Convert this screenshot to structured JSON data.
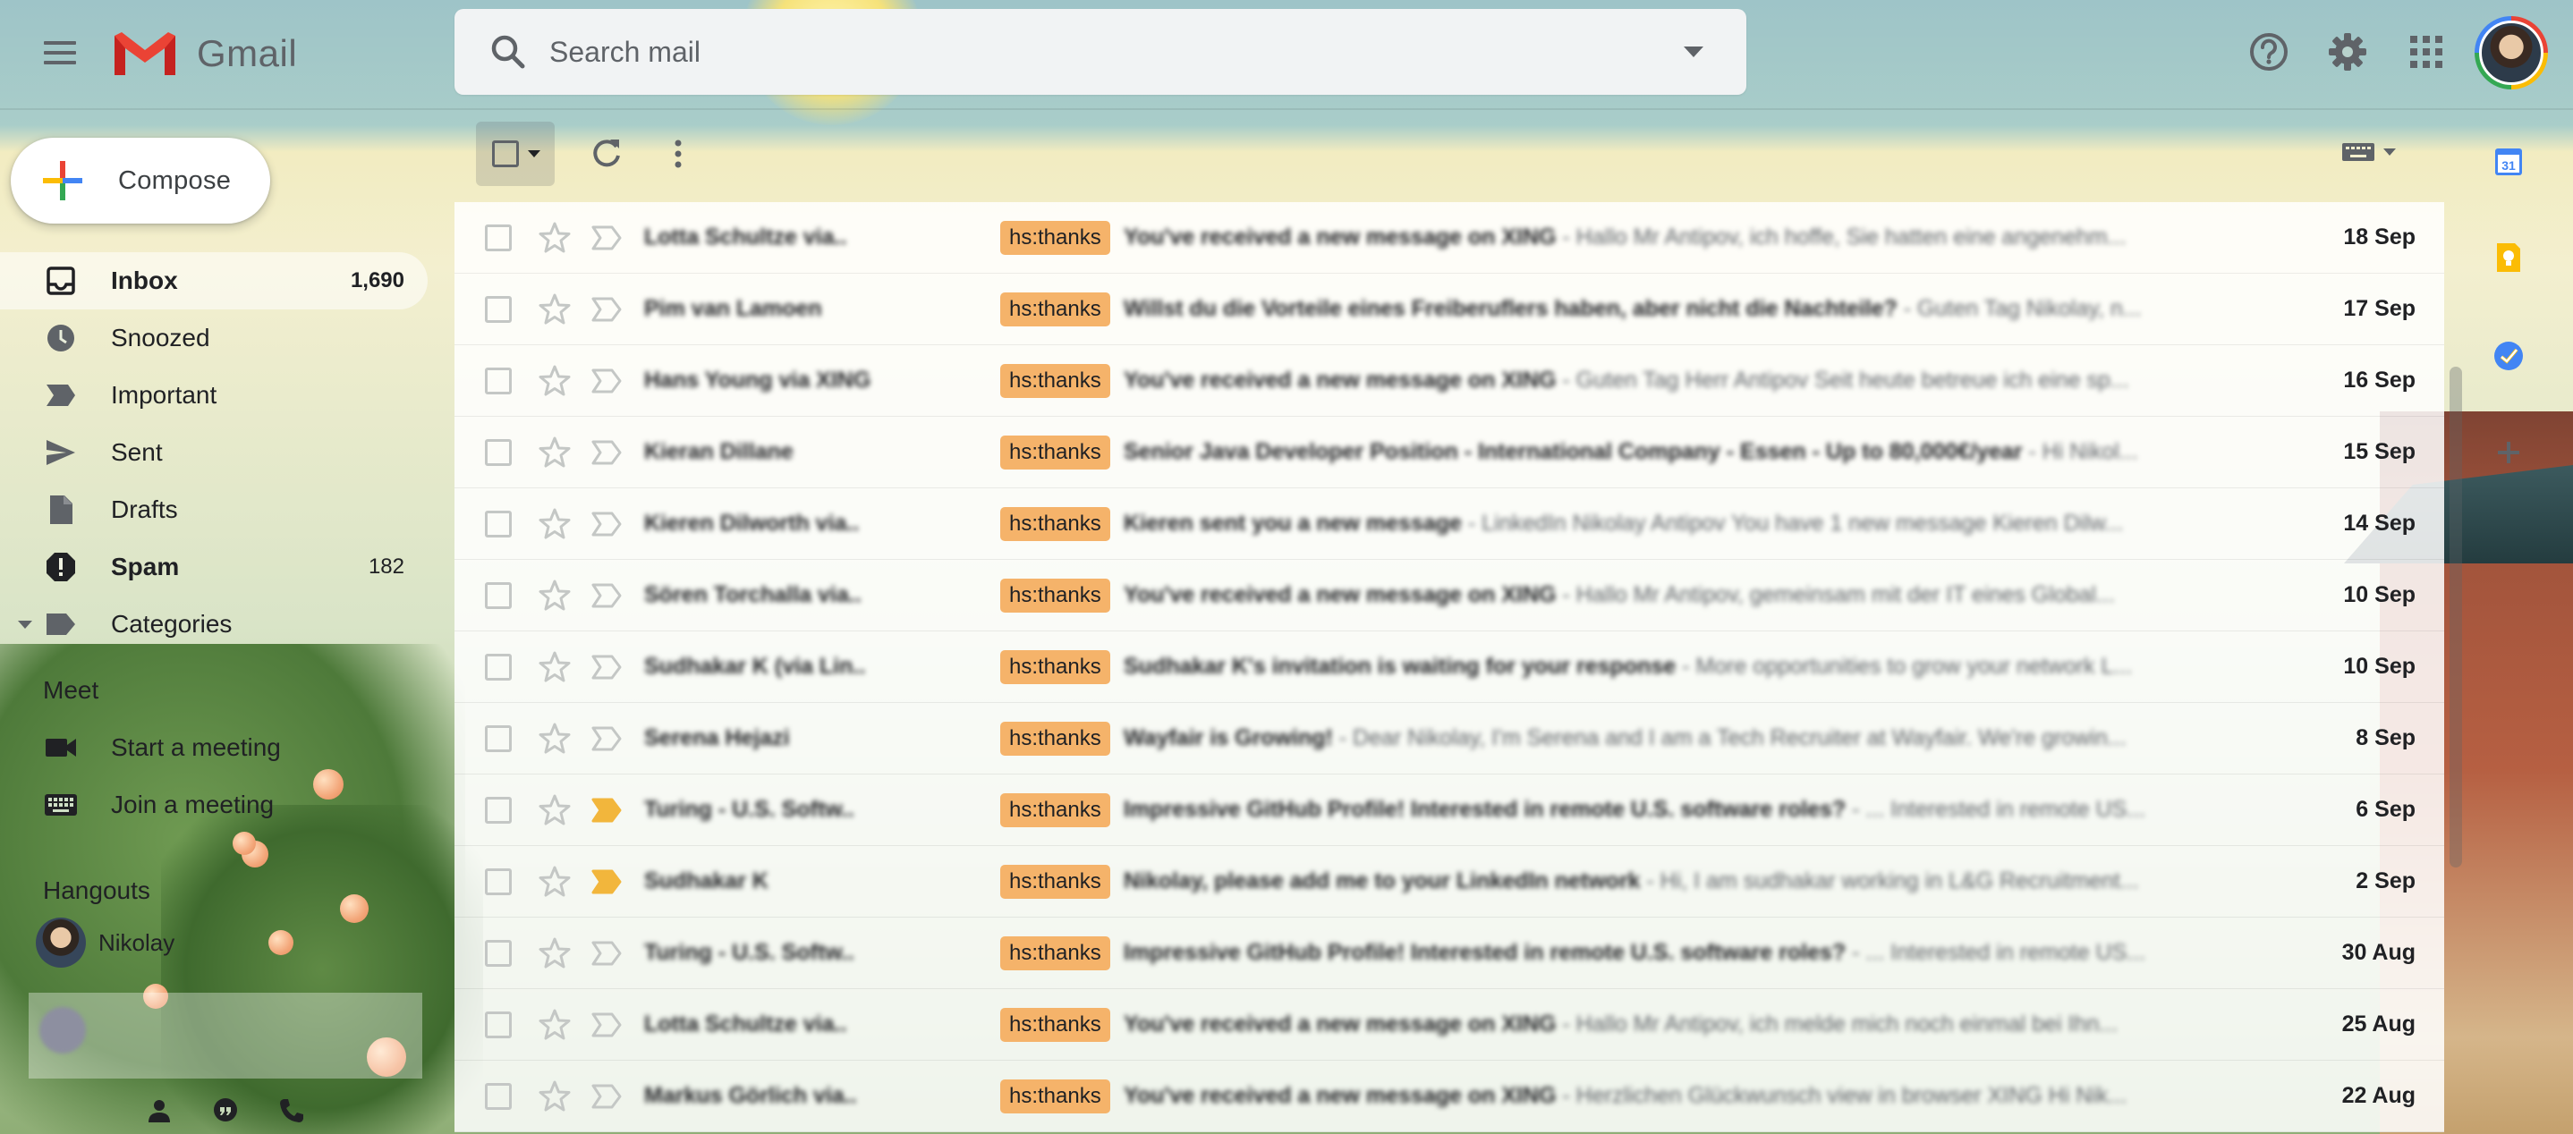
{
  "app": {
    "name": "Gmail"
  },
  "search": {
    "placeholder": "Search mail"
  },
  "compose": {
    "label": "Compose"
  },
  "nav": {
    "items": [
      {
        "label": "Inbox",
        "count": "1,690",
        "icon": "inbox-icon",
        "active": true,
        "bold": true
      },
      {
        "label": "Snoozed",
        "count": "",
        "icon": "clock-icon",
        "active": false,
        "bold": false
      },
      {
        "label": "Important",
        "count": "",
        "icon": "important-icon",
        "active": false,
        "bold": false
      },
      {
        "label": "Sent",
        "count": "",
        "icon": "send-icon",
        "active": false,
        "bold": false
      },
      {
        "label": "Drafts",
        "count": "",
        "icon": "draft-icon",
        "active": false,
        "bold": false
      },
      {
        "label": "Spam",
        "count": "182",
        "icon": "spam-icon",
        "active": false,
        "bold": true
      },
      {
        "label": "Categories",
        "count": "",
        "icon": "label-icon",
        "active": false,
        "bold": false
      }
    ]
  },
  "meet": {
    "title": "Meet",
    "start": "Start a meeting",
    "join": "Join a meeting"
  },
  "hangouts": {
    "title": "Hangouts",
    "user": "Nikolay"
  },
  "emails": [
    {
      "sender": "Lotta Schultze via..",
      "label": "hs:thanks",
      "subject": "You've received a new message on XING",
      "snippet": " - Hallo Mr Antipov, ich hoffe, Sie hatten eine angenehm...",
      "date": "18 Sep",
      "important": false
    },
    {
      "sender": "Pim van Lamoen",
      "label": "hs:thanks",
      "subject": "Willst du die Vorteile eines Freiberuflers haben, aber nicht die Nachteile?",
      "snippet": " - Guten Tag Nikolay, n...",
      "date": "17 Sep",
      "important": false
    },
    {
      "sender": "Hans Young via XING",
      "label": "hs:thanks",
      "subject": "You've received a new message on XING",
      "snippet": " - Guten Tag Herr Antipov Seit heute betreue ich eine sp...",
      "date": "16 Sep",
      "important": false
    },
    {
      "sender": "Kieran Dillane",
      "label": "hs:thanks",
      "subject": "Senior Java Developer Position - International Company - Essen - Up to 80,000€/year",
      "snippet": " - Hi Nikol...",
      "date": "15 Sep",
      "important": false
    },
    {
      "sender": "Kieren Dilworth via..",
      "label": "hs:thanks",
      "subject": "Kieren sent you a new message",
      "snippet": " - LinkedIn Nikolay Antipov You have 1 new message Kieren Dilw...",
      "date": "14 Sep",
      "important": false
    },
    {
      "sender": "Sören Torchalla via..",
      "label": "hs:thanks",
      "subject": "You've received a new message on XING",
      "snippet": " - Hallo Mr Antipov, gemeinsam mit der IT eines Global...",
      "date": "10 Sep",
      "important": false
    },
    {
      "sender": "Sudhakar K (via Lin..",
      "label": "hs:thanks",
      "subject": "Sudhakar K's invitation is waiting for your response",
      "snippet": " - More opportunities to grow your network L...",
      "date": "10 Sep",
      "important": false
    },
    {
      "sender": "Serena Hejazi",
      "label": "hs:thanks",
      "subject": "Wayfair is Growing!",
      "snippet": " - Dear Nikolay, I'm Serena and I am a Tech Recruiter at Wayfair. We're growin...",
      "date": "8 Sep",
      "important": false
    },
    {
      "sender": "Turing - U.S. Softw..",
      "label": "hs:thanks",
      "subject": "Impressive GitHub Profile! Interested in remote U.S. software roles?",
      "snippet": " - ... Interested in remote US...",
      "date": "6 Sep",
      "important": true
    },
    {
      "sender": "Sudhakar K",
      "label": "hs:thanks",
      "subject": "Nikolay, please add me to your LinkedIn network",
      "snippet": " - Hi, I am sudhakar working in L&G Recruitment...",
      "date": "2 Sep",
      "important": true
    },
    {
      "sender": "Turing - U.S. Softw..",
      "label": "hs:thanks",
      "subject": "Impressive GitHub Profile! Interested in remote U.S. software roles?",
      "snippet": " - ... Interested in remote US...",
      "date": "30 Aug",
      "important": false
    },
    {
      "sender": "Lotta Schultze via..",
      "label": "hs:thanks",
      "subject": "You've received a new message on XING",
      "snippet": " - Hallo Mr Antipov, ich melde mich noch einmal bei Ihn...",
      "date": "25 Aug",
      "important": false
    },
    {
      "sender": "Markus Görlich via..",
      "label": "hs:thanks",
      "subject": "You've received a new message on XING",
      "snippet": " - Herzlichen Glückwunsch view in browser XING Hi Nik...",
      "date": "22 Aug",
      "important": false
    }
  ],
  "side_panel": {
    "calendar_day": "31"
  },
  "colors": {
    "label_bg": "#f5b36a",
    "important_marker": "#f2b63c",
    "accent_red": "#ea4335"
  }
}
